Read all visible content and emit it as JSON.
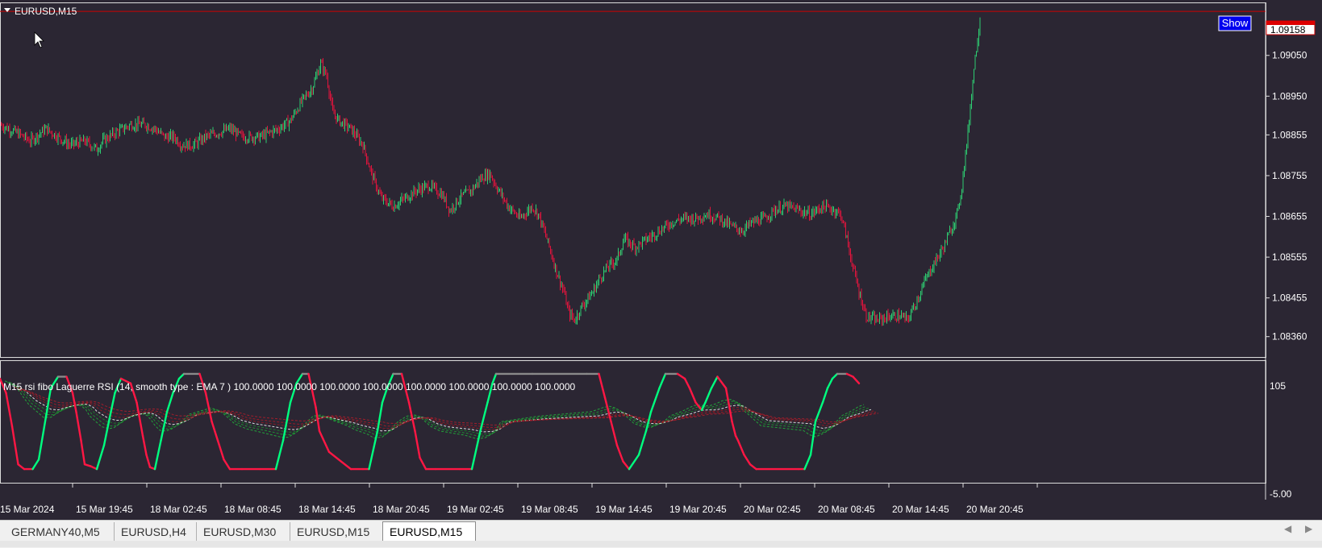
{
  "window": {
    "symbol_label": "EURUSD,M15",
    "show_button": "Show"
  },
  "price_axis": {
    "labels": [
      "1.09050",
      "1.08950",
      "1.08855",
      "1.08755",
      "1.08655",
      "1.08555",
      "1.08455",
      "1.08360"
    ],
    "current_price": "1.09158"
  },
  "indicator": {
    "title": "M15 rsi fibo Laguerre RSI (14, smooth type : EMA  7 ) 100.0000 100.0000 100.0000 100.0000 100.0000 100.0000 100.0000 100.0000",
    "axis_top": "105",
    "axis_bottom": "-5.00"
  },
  "time_axis": {
    "labels": [
      "15 Mar 2024",
      "15 Mar 19:45",
      "18 Mar 02:45",
      "18 Mar 08:45",
      "18 Mar 14:45",
      "18 Mar 20:45",
      "19 Mar 02:45",
      "19 Mar 08:45",
      "19 Mar 14:45",
      "19 Mar 20:45",
      "20 Mar 02:45",
      "20 Mar 08:45",
      "20 Mar 14:45",
      "20 Mar 20:45"
    ]
  },
  "tabs": [
    {
      "label": "GERMANY40,M5",
      "active": false
    },
    {
      "label": "EURUSD,H4",
      "active": false
    },
    {
      "label": "EURUSD,M30",
      "active": false
    },
    {
      "label": "EURUSD,M15",
      "active": false
    },
    {
      "label": "EURUSD,M15",
      "active": true
    }
  ],
  "colors": {
    "background": "#2b2633",
    "bull": "#2ecc71",
    "bear": "#e0143c",
    "rsi_up": "#00ff7f",
    "rsi_down": "#ff1744",
    "current_price_line": "#cc0000",
    "show_button_bg": "#0000ee"
  },
  "chart_data": [
    {
      "type": "candlestick",
      "title": "EURUSD,M15",
      "ylim": [
        1.0831,
        1.0918
      ],
      "y_ticks": [
        1.0905,
        1.0895,
        1.08855,
        1.08755,
        1.08655,
        1.08555,
        1.08455,
        1.0836
      ],
      "current_price": 1.09158,
      "close_path": [
        [
          0,
          1.0888
        ],
        [
          14,
          1.0886
        ],
        [
          25,
          1.0884
        ],
        [
          38,
          1.0887
        ],
        [
          48,
          1.0885
        ],
        [
          58,
          1.0883
        ],
        [
          70,
          1.0884
        ],
        [
          80,
          1.0882
        ],
        [
          85,
          1.0884
        ],
        [
          95,
          1.0886
        ],
        [
          108,
          1.0888
        ],
        [
          120,
          1.0888
        ],
        [
          128,
          1.0887
        ],
        [
          136,
          1.0885
        ],
        [
          144,
          1.0885
        ],
        [
          150,
          1.0883
        ],
        [
          160,
          1.0883
        ],
        [
          170,
          1.0885
        ],
        [
          180,
          1.0886
        ],
        [
          190,
          1.0887
        ],
        [
          200,
          1.0885
        ],
        [
          215,
          1.0885
        ],
        [
          230,
          1.0887
        ],
        [
          240,
          1.0889
        ],
        [
          250,
          1.0894
        ],
        [
          258,
          1.0897
        ],
        [
          265,
          1.0903
        ],
        [
          270,
          1.09
        ],
        [
          275,
          1.0891
        ],
        [
          280,
          1.0889
        ],
        [
          290,
          1.0887
        ],
        [
          300,
          1.0883
        ],
        [
          307,
          1.0876
        ],
        [
          315,
          1.087
        ],
        [
          325,
          1.0868
        ],
        [
          335,
          1.087
        ],
        [
          345,
          1.0872
        ],
        [
          355,
          1.0873
        ],
        [
          365,
          1.0871
        ],
        [
          372,
          1.0867
        ],
        [
          380,
          1.087
        ],
        [
          390,
          1.0872
        ],
        [
          398,
          1.0875
        ],
        [
          405,
          1.0876
        ],
        [
          410,
          1.0873
        ],
        [
          420,
          1.0868
        ],
        [
          430,
          1.0865
        ],
        [
          440,
          1.0868
        ],
        [
          445,
          1.0866
        ],
        [
          452,
          1.086
        ],
        [
          460,
          1.0852
        ],
        [
          466,
          1.0847
        ],
        [
          470,
          1.0842
        ],
        [
          475,
          1.084
        ],
        [
          480,
          1.0843
        ],
        [
          490,
          1.0847
        ],
        [
          495,
          1.085
        ],
        [
          502,
          1.0853
        ],
        [
          510,
          1.0855
        ],
        [
          516,
          1.086
        ],
        [
          525,
          1.0858
        ],
        [
          535,
          1.086
        ],
        [
          545,
          1.0862
        ],
        [
          555,
          1.0864
        ],
        [
          565,
          1.0865
        ],
        [
          575,
          1.0865
        ],
        [
          585,
          1.0866
        ],
        [
          595,
          1.0865
        ],
        [
          605,
          1.0863
        ],
        [
          613,
          1.0862
        ],
        [
          622,
          1.0864
        ],
        [
          632,
          1.0865
        ],
        [
          640,
          1.0867
        ],
        [
          650,
          1.0868
        ],
        [
          660,
          1.0867
        ],
        [
          670,
          1.0866
        ],
        [
          680,
          1.0868
        ],
        [
          690,
          1.0867
        ],
        [
          695,
          1.0866
        ],
        [
          700,
          1.086
        ],
        [
          705,
          1.0853
        ],
        [
          710,
          1.0847
        ],
        [
          716,
          1.0841
        ],
        [
          725,
          1.084
        ],
        [
          735,
          1.0841
        ],
        [
          745,
          1.0841
        ],
        [
          750,
          1.084
        ],
        [
          758,
          1.0845
        ],
        [
          765,
          1.085
        ],
        [
          772,
          1.0854
        ],
        [
          780,
          1.0858
        ],
        [
          787,
          1.0863
        ],
        [
          792,
          1.0867
        ],
        [
          795,
          1.0873
        ],
        [
          800,
          1.0886
        ],
        [
          805,
          1.0902
        ],
        [
          810,
          1.0914
        ]
      ]
    },
    {
      "type": "line",
      "title": "M15 rsi fibo Laguerre RSI (14, smooth type : EMA  7 )",
      "ylim": [
        -5,
        105
      ],
      "y_ticks": [
        105,
        -5
      ],
      "series": [
        {
          "values": [
            [
              0,
              95
            ],
            [
              5,
              80
            ],
            [
              10,
              45
            ],
            [
              15,
              5
            ],
            [
              20,
              0
            ],
            [
              27,
              0
            ],
            [
              32,
              10
            ],
            [
              38,
              55
            ],
            [
              42,
              85
            ],
            [
              48,
              97
            ],
            [
              55,
              97
            ],
            [
              60,
              80
            ],
            [
              63,
              60
            ],
            [
              67,
              30
            ],
            [
              70,
              5
            ],
            [
              75,
              3
            ],
            [
              80,
              0
            ],
            [
              86,
              25
            ],
            [
              90,
              50
            ],
            [
              95,
              80
            ],
            [
              100,
              95
            ],
            [
              108,
              90
            ],
            [
              113,
              70
            ],
            [
              118,
              35
            ],
            [
              121,
              15
            ],
            [
              124,
              2
            ],
            [
              128,
              0
            ],
            [
              133,
              30
            ],
            [
              138,
              60
            ],
            [
              143,
              80
            ],
            [
              148,
              95
            ],
            [
              152,
              100
            ],
            [
              165,
              100
            ],
            [
              170,
              80
            ],
            [
              175,
              50
            ],
            [
              180,
              30
            ],
            [
              185,
              10
            ],
            [
              190,
              0
            ],
            [
              200,
              0
            ],
            [
              215,
              0
            ],
            [
              228,
              0
            ],
            [
              234,
              30
            ],
            [
              240,
              70
            ],
            [
              245,
              90
            ],
            [
              250,
              100
            ],
            [
              255,
              100
            ],
            [
              261,
              65
            ],
            [
              264,
              40
            ],
            [
              272,
              18
            ],
            [
              282,
              8
            ],
            [
              290,
              0
            ],
            [
              300,
              0
            ],
            [
              305,
              0
            ],
            [
              312,
              40
            ],
            [
              316,
              70
            ],
            [
              320,
              85
            ],
            [
              325,
              100
            ],
            [
              332,
              100
            ],
            [
              338,
              70
            ],
            [
              343,
              40
            ],
            [
              347,
              12
            ],
            [
              352,
              0
            ],
            [
              360,
              0
            ],
            [
              380,
              0
            ],
            [
              390,
              0
            ],
            [
              397,
              40
            ],
            [
              403,
              70
            ],
            [
              407,
              90
            ],
            [
              410,
              100
            ],
            [
              440,
              100
            ],
            [
              485,
              100
            ],
            [
              495,
              100
            ],
            [
              500,
              75
            ],
            [
              505,
              50
            ],
            [
              510,
              25
            ],
            [
              515,
              8
            ],
            [
              520,
              0
            ],
            [
              528,
              15
            ],
            [
              534,
              40
            ],
            [
              538,
              60
            ],
            [
              545,
              85
            ],
            [
              550,
              100
            ],
            [
              560,
              100
            ],
            [
              566,
              95
            ],
            [
              570,
              85
            ],
            [
              575,
              70
            ],
            [
              580,
              62
            ],
            [
              583,
              70
            ],
            [
              588,
              85
            ],
            [
              593,
              97
            ],
            [
              600,
              85
            ],
            [
              605,
              50
            ],
            [
              608,
              35
            ],
            [
              610,
              30
            ],
            [
              615,
              15
            ],
            [
              620,
              5
            ],
            [
              625,
              0
            ],
            [
              660,
              0
            ],
            [
              665,
              0
            ],
            [
              670,
              15
            ],
            [
              674,
              50
            ],
            [
              680,
              70
            ],
            [
              684,
              85
            ],
            [
              688,
              95
            ],
            [
              692,
              100
            ],
            [
              700,
              100
            ],
            [
              705,
              97
            ],
            [
              710,
              90
            ]
          ]
        }
      ]
    }
  ]
}
